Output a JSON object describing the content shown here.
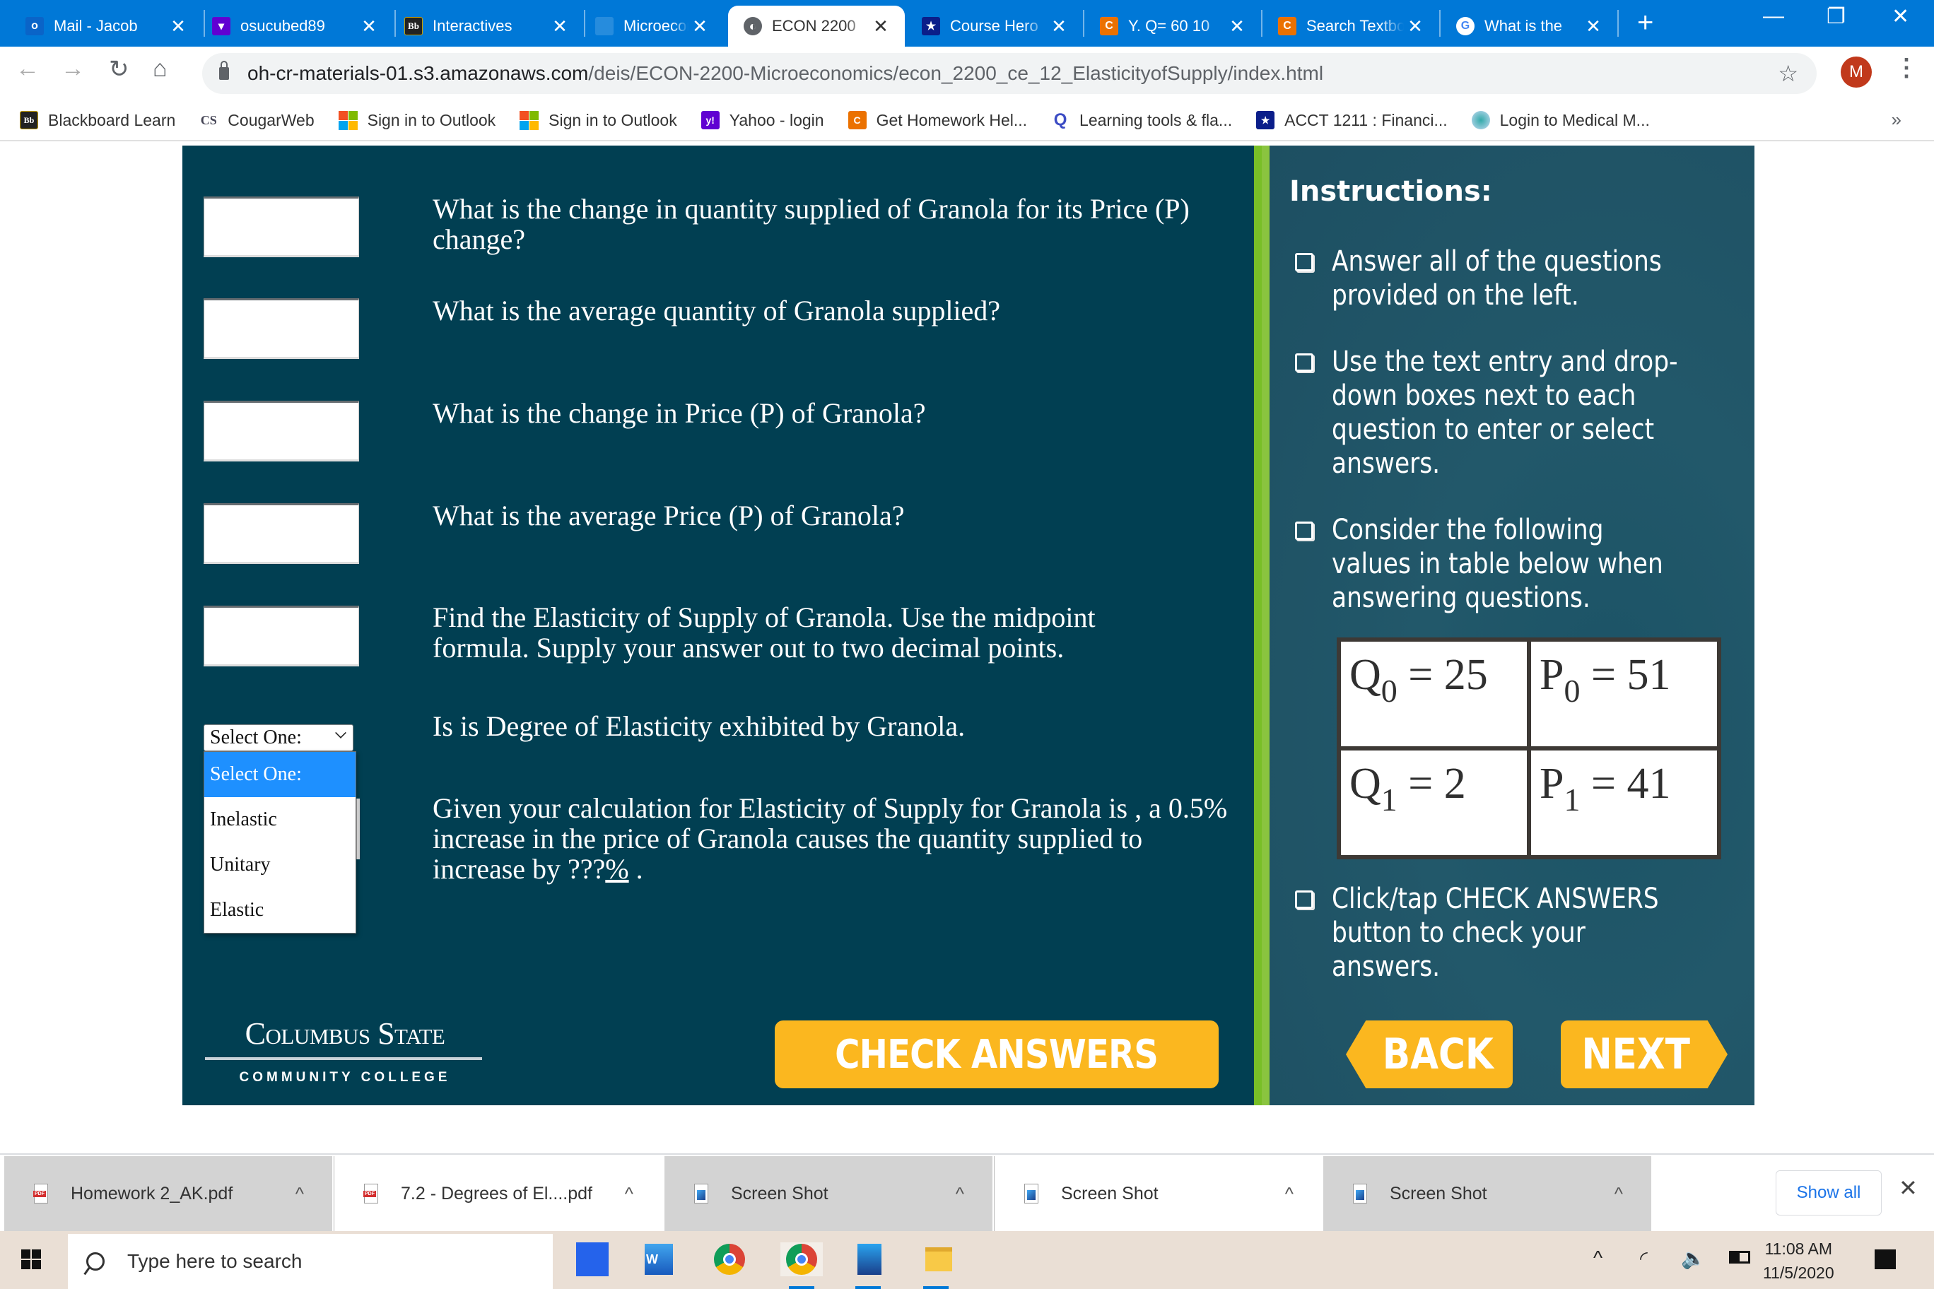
{
  "browser": {
    "tabs": [
      {
        "title": "Mail - Jacob",
        "icon": "outlook-icon",
        "active": false
      },
      {
        "title": "osucubed89",
        "icon": "yahoo-mail-icon",
        "active": false
      },
      {
        "title": "Interactives",
        "icon": "blackboard-icon",
        "active": false
      },
      {
        "title": "Microeconomics",
        "icon": "page-icon",
        "active": false
      },
      {
        "title": "ECON 2200",
        "icon": "globe-icon",
        "active": true
      },
      {
        "title": "Course Hero",
        "icon": "course-hero-icon",
        "active": false
      },
      {
        "title": "Y. Q= 60 10",
        "icon": "chegg-icon",
        "active": false
      },
      {
        "title": "Search Textbook",
        "icon": "chegg-icon",
        "active": false
      },
      {
        "title": "What is the",
        "icon": "google-icon",
        "active": false
      }
    ],
    "close_glyph": "✕",
    "new_tab_glyph": "+",
    "window_controls": {
      "minimize": "—",
      "restore": "❐",
      "close": "✕"
    },
    "url_host": "oh-cr-materials-01.s3.amazonaws.com",
    "url_path": "/deis/ECON-2200-Microeconomics/econ_2200_ce_12_ElasticityofSupply/index.html",
    "profile_initial": "M",
    "bookmarks": [
      {
        "label": "Blackboard Learn",
        "icon": "blackboard-icon"
      },
      {
        "label": "CougarWeb",
        "icon": "cougarweb-icon"
      },
      {
        "label": "Sign in to Outlook",
        "icon": "microsoft-icon"
      },
      {
        "label": "Sign in to Outlook",
        "icon": "microsoft-icon"
      },
      {
        "label": "Yahoo - login",
        "icon": "yahoo-icon"
      },
      {
        "label": "Get Homework Hel...",
        "icon": "chegg-icon"
      },
      {
        "label": "Learning tools & fla...",
        "icon": "quizlet-icon"
      },
      {
        "label": "ACCT 1211 : Financi...",
        "icon": "course-hero-icon"
      },
      {
        "label": "Login to Medical M...",
        "icon": "medical-icon"
      }
    ],
    "bookmarks_more": "»"
  },
  "activity": {
    "questions": [
      {
        "text": "What is the change in quantity supplied of Granola for its Price (P) change?",
        "input_value": ""
      },
      {
        "text": "What is the average quantity of Granola supplied?",
        "input_value": ""
      },
      {
        "text": "What is the change in Price (P) of Granola?",
        "input_value": ""
      },
      {
        "text": "What is the average  Price (P) of Granola?",
        "input_value": ""
      },
      {
        "text": "Find the Elasticity of Supply of Granola. Use the midpoint formula. Supply your answer out to two decimal points.",
        "input_value": ""
      },
      {
        "text": "Is is Degree of Elasticity exhibited by Granola."
      },
      {
        "text_before": "Given your calculation for Elasticity of Supply for Granola is , a 0.5% increase in the price of Granola causes the quantity supplied to increase by ???",
        "text_underlined": "%",
        "text_after": " ."
      }
    ],
    "select": {
      "value": "Select One:",
      "options": [
        "Select One:",
        "Inelastic",
        "Unitary",
        "Elastic"
      ],
      "highlighted": "Select One:"
    },
    "logo": {
      "line1": "Columbus State",
      "line2": "COMMUNITY COLLEGE"
    },
    "check_answers_label": "CHECK ANSWERS",
    "instructions": {
      "title": "Instructions:",
      "items": [
        "Answer all of the questions provided on the left.",
        "Use the text entry and drop-down boxes next to each question to enter or select answers.",
        "Consider the following values in table below when answering questions.",
        "Click/tap CHECK ANSWERS button to check your answers."
      ]
    },
    "values_table": [
      {
        "var": "Q",
        "sub": "0",
        "value": "25"
      },
      {
        "var": "P",
        "sub": "0",
        "value": "51"
      },
      {
        "var": "Q",
        "sub": "1",
        "value": "2"
      },
      {
        "var": "P",
        "sub": "1",
        "value": "41"
      }
    ],
    "back_label": "BACK",
    "next_label": "NEXT"
  },
  "downloads": {
    "items": [
      {
        "name": "Homework 2_AK.pdf",
        "type": "pdf"
      },
      {
        "name": "7.2 - Degrees of El....pdf",
        "type": "pdf"
      },
      {
        "name": "Screen Shot",
        "type": "image"
      },
      {
        "name": "Screen Shot",
        "type": "image"
      },
      {
        "name": "Screen Shot",
        "type": "image"
      }
    ],
    "caret": "^",
    "show_all": "Show all",
    "close": "✕"
  },
  "taskbar": {
    "search_placeholder": "Type here to search",
    "time": "11:08 AM",
    "date": "11/5/2020"
  },
  "colors": {
    "browser_blue": "#0078d7",
    "stage_bg": "#013f52",
    "accent_green": "#79bf27",
    "button_yellow": "#fbb71f",
    "dropdown_highlight": "#1e90ff"
  }
}
